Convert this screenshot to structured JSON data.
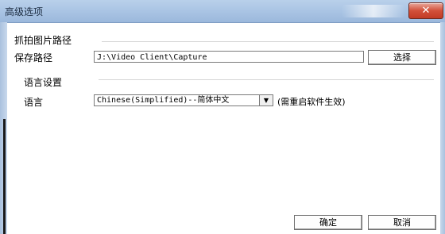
{
  "window": {
    "title": "高级选项",
    "close_glyph": "✕"
  },
  "capture_section": {
    "header": "抓拍图片路径",
    "path_label": "保存路径",
    "path_value": "J:\\Video Client\\Capture",
    "browse_button": "选择"
  },
  "language_section": {
    "header": "语言设置",
    "language_label": "语言",
    "selected_language": "Chinese(Simplified)--简体中文",
    "dropdown_glyph": "▼",
    "restart_note": "(需重启软件生效)"
  },
  "footer": {
    "ok_button": "确定",
    "cancel_button": "取消"
  }
}
